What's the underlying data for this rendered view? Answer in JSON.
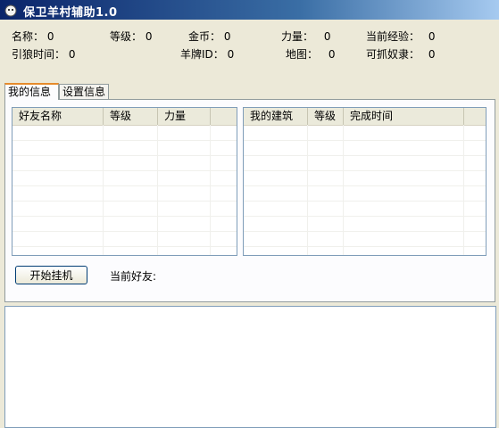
{
  "window": {
    "title": "保卫羊村辅助1.0",
    "icon": "sheep-app-icon"
  },
  "status": {
    "name": {
      "label": "名称：",
      "value": "0"
    },
    "level": {
      "label": "等级：",
      "value": "0"
    },
    "gold": {
      "label": "金币：",
      "value": "0"
    },
    "power": {
      "label": "力量：",
      "value": "0"
    },
    "exp": {
      "label": "当前经验：",
      "value": "0"
    },
    "lure_time": {
      "label": "引狼时间：",
      "value": "0"
    },
    "badge_id": {
      "label": "羊牌ID：",
      "value": "0"
    },
    "map": {
      "label": "地图：",
      "value": "0"
    },
    "catchable": {
      "label": "可抓奴隶：",
      "value": "0"
    }
  },
  "tabs": [
    {
      "label": "我的信息",
      "active": true
    },
    {
      "label": "设置信息",
      "active": false
    }
  ],
  "friends_table": {
    "columns": [
      "好友名称",
      "等级",
      "力量",
      ""
    ],
    "rows": []
  },
  "buildings_table": {
    "columns": [
      "我的建筑",
      "等级",
      "完成时间"
    ],
    "rows": []
  },
  "controls": {
    "start_label": "开始挂机",
    "current_friend_label": "当前好友:",
    "current_friend_value": ""
  },
  "log": {
    "text": ""
  }
}
